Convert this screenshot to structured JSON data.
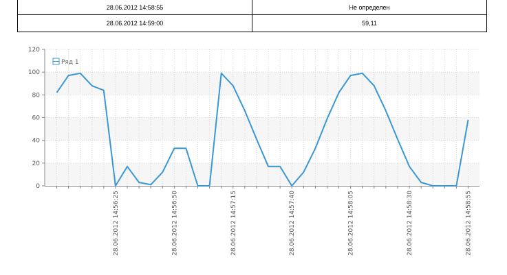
{
  "table": {
    "rows": [
      {
        "time": "28.06.2012 14:58:55",
        "value": "Не определен"
      },
      {
        "time": "28.06.2012 14:59:00",
        "value": "59,11"
      }
    ]
  },
  "colors": {
    "series": "#3a97d6",
    "grid": "#d4d4d4",
    "band": "#f6f6f6",
    "axis": "#888888"
  },
  "chart_data": {
    "type": "line",
    "legend": {
      "position": "top-left"
    },
    "grid": true,
    "ylim": [
      0,
      120
    ],
    "yticks": [
      0,
      20,
      40,
      60,
      80,
      100,
      120
    ],
    "x_labels": [
      {
        "index": 5,
        "label": "28.06.2012 14:56:25"
      },
      {
        "index": 10,
        "label": "28.06.2012 14:56:50"
      },
      {
        "index": 15,
        "label": "28.06.2012 14:57:15"
      },
      {
        "index": 20,
        "label": "28.06.2012 14:57:40"
      },
      {
        "index": 25,
        "label": "28.06.2012 14:58:05"
      },
      {
        "index": 30,
        "label": "28.06.2012 14:58:30"
      },
      {
        "index": 35,
        "label": "28.06.2012 14:58:55"
      }
    ],
    "series": [
      {
        "name": "Ряд 1",
        "values": [
          82,
          97,
          99,
          88,
          84,
          0,
          17,
          3,
          1,
          12,
          33,
          33,
          0,
          0,
          99,
          88,
          66,
          41,
          17,
          17,
          0,
          12,
          33,
          59,
          82,
          97,
          99,
          88,
          66,
          41,
          17,
          3,
          0,
          0,
          0,
          58
        ]
      }
    ]
  }
}
